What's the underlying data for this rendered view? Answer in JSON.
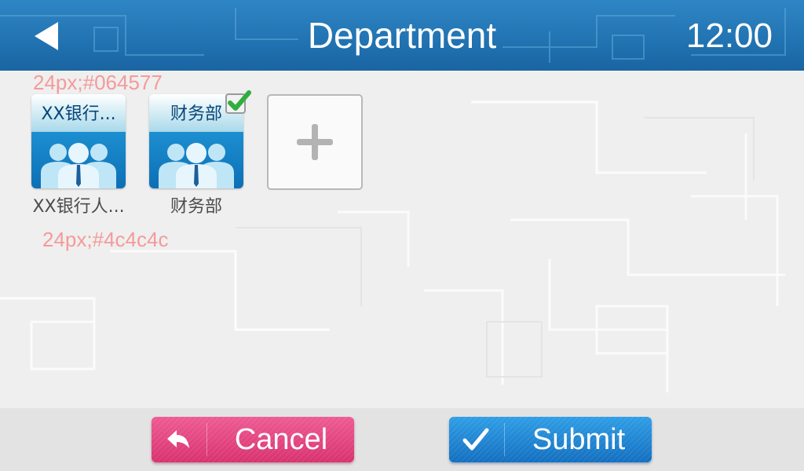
{
  "header": {
    "title": "Department",
    "time": "12:00",
    "back_icon": "back-arrow-icon"
  },
  "annotations": {
    "title_spec": "24px;#064577",
    "label_spec": "24px;#4c4c4c"
  },
  "departments": [
    {
      "tile_text": "XX银行...",
      "label": "XX银行人...",
      "selected": false,
      "icon": "group-people-icon"
    },
    {
      "tile_text": "财务部",
      "label": "财务部",
      "selected": true,
      "icon": "group-people-icon"
    }
  ],
  "add_tile": {
    "icon": "plus-icon"
  },
  "actions": {
    "cancel_label": "Cancel",
    "submit_label": "Submit",
    "cancel_icon": "reply-arrow-icon",
    "submit_icon": "checkmark-icon"
  },
  "colors": {
    "header_blue": "#1f6fae",
    "tile_title": "#064577",
    "label_gray": "#4c4c4c",
    "annotation": "#f59a9a",
    "cancel_pink": "#d8326f",
    "submit_blue": "#136fc0",
    "check_green": "#2fae3f"
  }
}
